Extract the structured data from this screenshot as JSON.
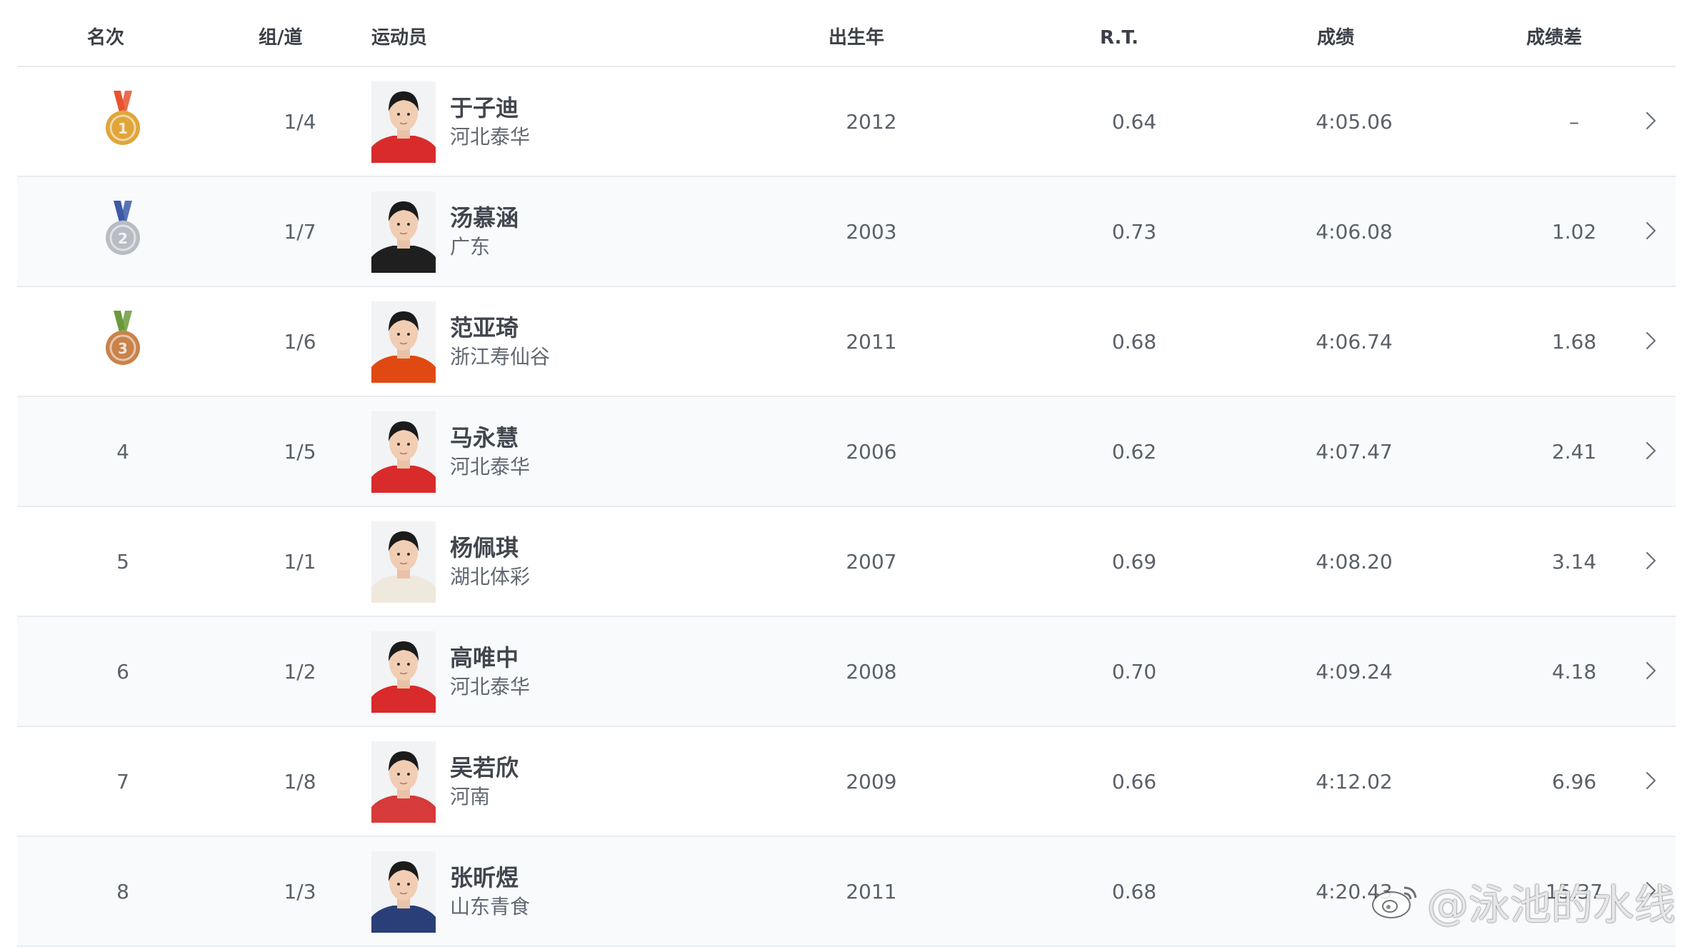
{
  "header": {
    "rank": "名次",
    "lane": "组/道",
    "athlete": "运动员",
    "birth_year": "出生年",
    "rt": "R.T.",
    "result": "成绩",
    "diff": "成绩差"
  },
  "rows": [
    {
      "rank": "",
      "medal": "gold-medal-icon",
      "lane": "1/4",
      "name": "于子迪",
      "team": "河北泰华",
      "year": "2012",
      "rt": "0.64",
      "result": "4:05.06",
      "diff": "–",
      "shirt": "#d92b2b"
    },
    {
      "rank": "",
      "medal": "silver-medal-icon",
      "lane": "1/7",
      "name": "汤慕涵",
      "team": "广东",
      "year": "2003",
      "rt": "0.73",
      "result": "4:06.08",
      "diff": "1.02",
      "shirt": "#1f1f1f"
    },
    {
      "rank": "",
      "medal": "bronze-medal-icon",
      "lane": "1/6",
      "name": "范亚琦",
      "team": "浙江寿仙谷",
      "year": "2011",
      "rt": "0.68",
      "result": "4:06.74",
      "diff": "1.68",
      "shirt": "#e04a12"
    },
    {
      "rank": "4",
      "medal": "",
      "lane": "1/5",
      "name": "马永慧",
      "team": "河北泰华",
      "year": "2006",
      "rt": "0.62",
      "result": "4:07.47",
      "diff": "2.41",
      "shirt": "#d92b2b"
    },
    {
      "rank": "5",
      "medal": "",
      "lane": "1/1",
      "name": "杨佩琪",
      "team": "湖北体彩",
      "year": "2007",
      "rt": "0.69",
      "result": "4:08.20",
      "diff": "3.14",
      "shirt": "#efe8dc"
    },
    {
      "rank": "6",
      "medal": "",
      "lane": "1/2",
      "name": "高唯中",
      "team": "河北泰华",
      "year": "2008",
      "rt": "0.70",
      "result": "4:09.24",
      "diff": "4.18",
      "shirt": "#d92b2b"
    },
    {
      "rank": "7",
      "medal": "",
      "lane": "1/8",
      "name": "吴若欣",
      "team": "河南",
      "year": "2009",
      "rt": "0.66",
      "result": "4:12.02",
      "diff": "6.96",
      "shirt": "#d63a3a"
    },
    {
      "rank": "8",
      "medal": "",
      "lane": "1/3",
      "name": "张昕煜",
      "team": "山东青食",
      "year": "2011",
      "rt": "0.68",
      "result": "4:20.43",
      "diff": "15.37",
      "shirt": "#2a3f78"
    }
  ],
  "watermark": "@泳池的水线",
  "colors": {
    "gold": "#e0a53a",
    "silver": "#b9bcc2",
    "bronze": "#c9824a",
    "ribbon_gold": "#e8532f",
    "ribbon_silver": "#3c5aa8",
    "ribbon_bronze": "#6a9a3b"
  }
}
